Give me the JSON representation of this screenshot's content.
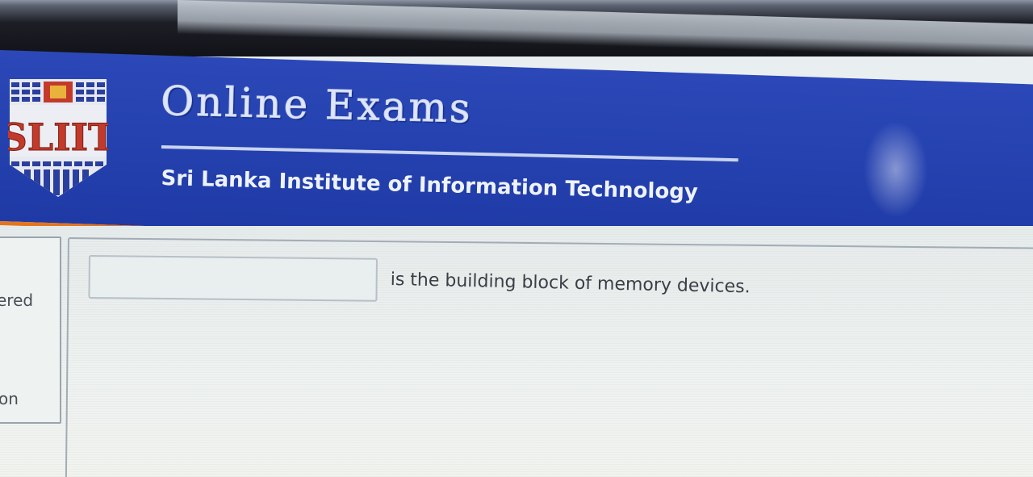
{
  "header": {
    "logo_text": "SLIIT",
    "title": "Online Exams",
    "subtitle": "Sri Lanka Institute of Information Technology"
  },
  "sidebar": {
    "lines": [
      "ered",
      "on"
    ]
  },
  "question": {
    "answer_value": "",
    "text": "is the building block of memory devices."
  },
  "colors": {
    "banner_blue": "#2542b0",
    "accent_orange": "#e2751f",
    "logo_red": "#c33a2b"
  }
}
